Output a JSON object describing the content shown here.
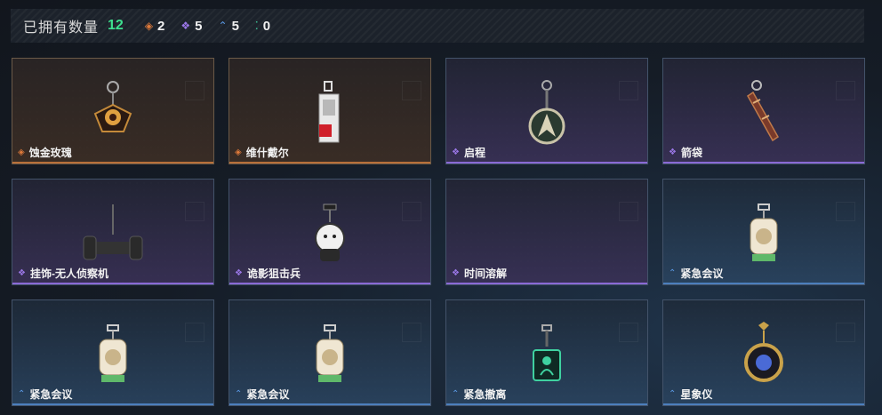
{
  "header": {
    "owned_label": "已拥有数量",
    "owned_count": "12",
    "stats": [
      {
        "icon": "orange-diamond-icon",
        "color": "#e07a3a",
        "value": "2"
      },
      {
        "icon": "purple-diamond-icon",
        "color": "#9a77e6",
        "value": "5"
      },
      {
        "icon": "blue-chevron-icon",
        "color": "#5b9ae6",
        "value": "5"
      },
      {
        "icon": "green-dots-icon",
        "color": "#3fd1a0",
        "value": "0"
      }
    ]
  },
  "items": [
    {
      "name": "蚀金玫瑰",
      "rarity": "orange",
      "icon": "gold-rose-charm-icon"
    },
    {
      "name": "维什戴尔",
      "rarity": "orange",
      "icon": "wisadel-tag-charm-icon"
    },
    {
      "name": "启程",
      "rarity": "purple",
      "icon": "compass-medal-charm-icon"
    },
    {
      "name": "箭袋",
      "rarity": "purple",
      "icon": "quiver-charm-icon"
    },
    {
      "name": "挂饰-无人侦察机",
      "rarity": "purple",
      "icon": "drone-charm-icon"
    },
    {
      "name": "诡影狙击兵",
      "rarity": "purple",
      "icon": "sniper-doll-charm-icon"
    },
    {
      "name": "时间溶解",
      "rarity": "purple",
      "icon": "empty-charm-icon"
    },
    {
      "name": "紧急会议",
      "rarity": "blue",
      "icon": "emergency-meeting-charm-icon"
    },
    {
      "name": "紧急会议",
      "rarity": "blue",
      "icon": "emergency-meeting-charm-icon"
    },
    {
      "name": "紧急会议",
      "rarity": "blue",
      "icon": "emergency-meeting-charm-icon"
    },
    {
      "name": "紧急撤离",
      "rarity": "blue",
      "icon": "evacuation-charm-icon"
    },
    {
      "name": "星象仪",
      "rarity": "blue",
      "icon": "astrolabe-charm-icon"
    }
  ]
}
